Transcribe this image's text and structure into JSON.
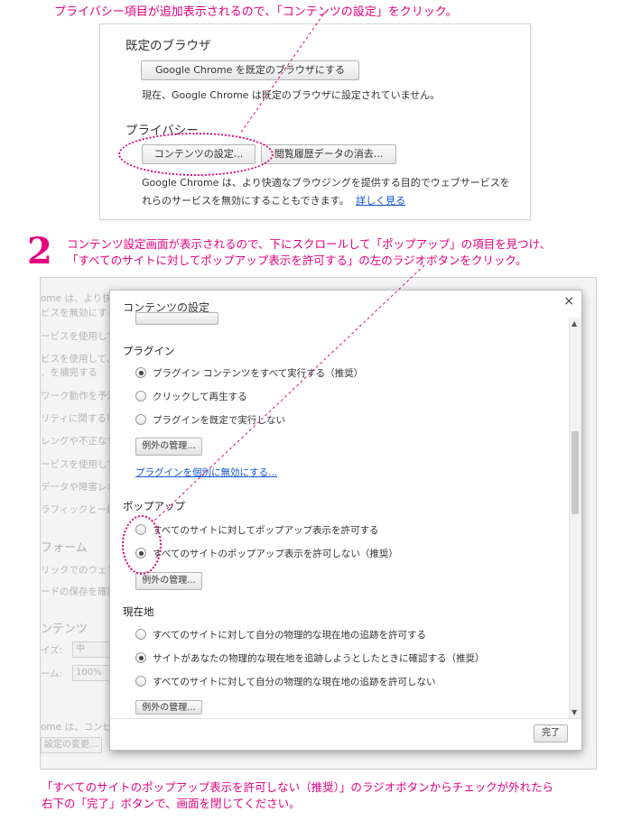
{
  "caption1": "プライバシー項目が追加表示されるので、「コンテンツの設定」をクリック。",
  "panel1": {
    "default_browser_heading": "既定のブラウザ",
    "make_default_button": "Google Chrome を既定のブラウザにする",
    "default_status": "現在、Google Chrome は既定のブラウザに設定されていません。",
    "privacy_heading": "プライバシー",
    "content_settings_button": "コンテンツの設定...",
    "clear_data_button": "閲覧履歴データの消去...",
    "privacy_text_1": "Google Chrome は、より快適なブラウジングを提供する目的でウェブサービスを",
    "privacy_text_2": "れらのサービスを無効にすることもできます。",
    "learn_more": "詳しく見る"
  },
  "step2": {
    "number": "2",
    "line1": "コンテンツ設定画面が表示されるので、下にスクロールして「ポップアップ」の項目を見つけ、",
    "line2": "「すべてのサイトに対してポップアップ表示を許可する」の左のラジオボタンをクリック。"
  },
  "background": {
    "lines": [
      "ome は、より快適",
      "ビスを無効にする",
      "ービスを使用して",
      "ビスを使用して、",
      "、を補完する",
      "ワーク動作を予測",
      "リティに関する事",
      "レングや不正なソ",
      "ービスを使用して",
      "データや障害レポ",
      "ラフィックと一緒に"
    ],
    "form_title": "フォーム",
    "form_lines": [
      "リックでのウェブ",
      "ードの保存を確認"
    ],
    "web_content_title": "ンテンツ",
    "font_size_label": "イズ:",
    "font_size_value": "中",
    "zoom_label": "ーム:",
    "zoom_value": "100%",
    "bottom_text": "ome は、コンピュ",
    "bottom_button": "設定の変更..."
  },
  "dialog": {
    "title": "コンテンツの設定",
    "close": "×",
    "plugins": {
      "heading": "プラグイン",
      "options": [
        {
          "label": "プラグイン コンテンツをすべて実行する（推奨）",
          "checked": true
        },
        {
          "label": "クリックして再生する",
          "checked": false
        },
        {
          "label": "プラグインを既定で実行しない",
          "checked": false
        }
      ],
      "manage_exceptions": "例外の管理...",
      "disable_link": "プラグインを個別に無効にする..."
    },
    "popups": {
      "heading": "ポップアップ",
      "options": [
        {
          "label": "すべてのサイトに対してポップアップ表示を許可する",
          "checked": false
        },
        {
          "label": "すべてのサイトのポップアップ表示を許可しない（推奨）",
          "checked": true
        }
      ],
      "manage_exceptions": "例外の管理..."
    },
    "location": {
      "heading": "現在地",
      "options": [
        {
          "label": "すべてのサイトに対して自分の物理的な現在地の追跡を許可する",
          "checked": false
        },
        {
          "label": "サイトがあなたの物理的な現在地を追跡しようとしたときに確認する（推奨）",
          "checked": true
        },
        {
          "label": "すべてのサイトに対して自分の物理的な現在地の追跡を許可しない",
          "checked": false
        }
      ],
      "manage_exceptions": "例外の管理..."
    },
    "done_button": "完了"
  },
  "caption3": {
    "line1": "「すべてのサイトのポップアップ表示を許可しない（推奨）」のラジオボタンからチェックが外れたら",
    "line2": "右下の「完了」ボタンで、画面を閉じてください。"
  },
  "colors": {
    "accent": "#e4007f",
    "link": "#1155cc"
  }
}
